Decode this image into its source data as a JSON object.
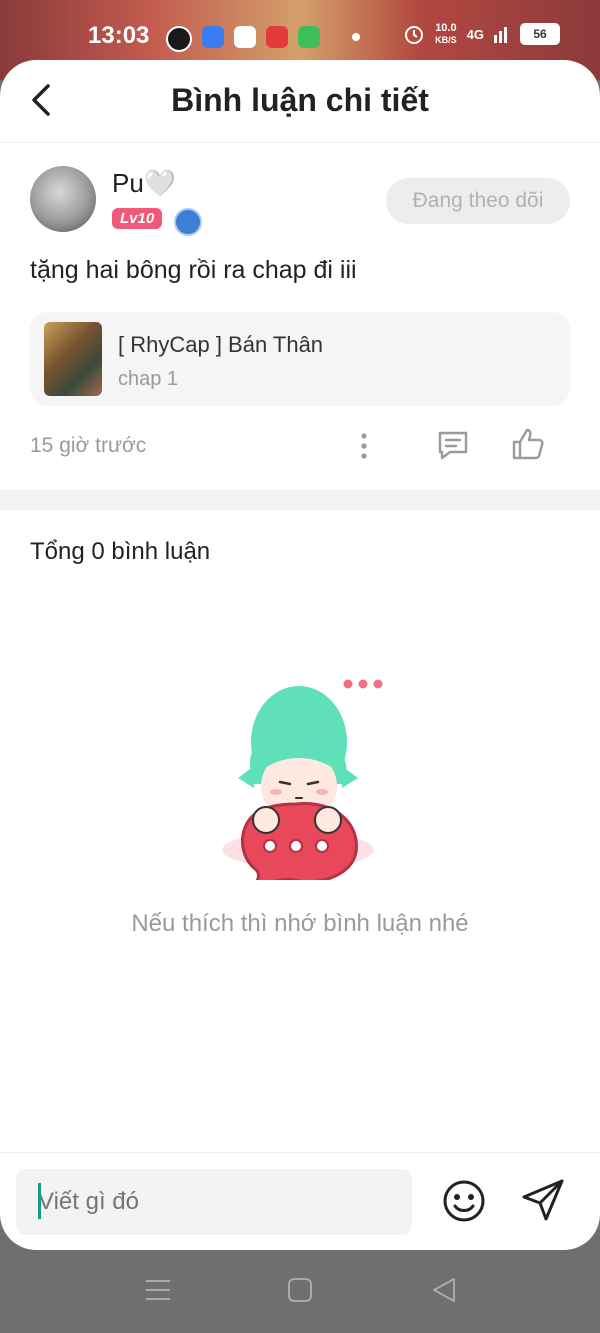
{
  "status_bar": {
    "time": "13:03",
    "net_speed": "10.0",
    "net_speed_unit": "KB/S",
    "network": "4G",
    "battery": "56"
  },
  "header": {
    "title": "Bình luận chi tiết"
  },
  "post": {
    "username": "Pu🤍",
    "level": "Lv10",
    "follow_label": "Đang theo dõi",
    "content": "tặng hai bông rồi ra chap đi iii",
    "chapter": {
      "name": "[ RhyCap ] Bán Thân",
      "sub": "chap 1"
    },
    "time_ago": "15 giờ trước"
  },
  "comments": {
    "total_label": "Tổng 0 bình luận",
    "empty_message": "Nếu thích thì nhớ bình luận nhé"
  },
  "composer": {
    "placeholder": "Viết gì đó"
  },
  "colors": {
    "accent_pink": "#f05a78",
    "teal": "#5fe0b8",
    "bubble_red": "#e8485a"
  }
}
